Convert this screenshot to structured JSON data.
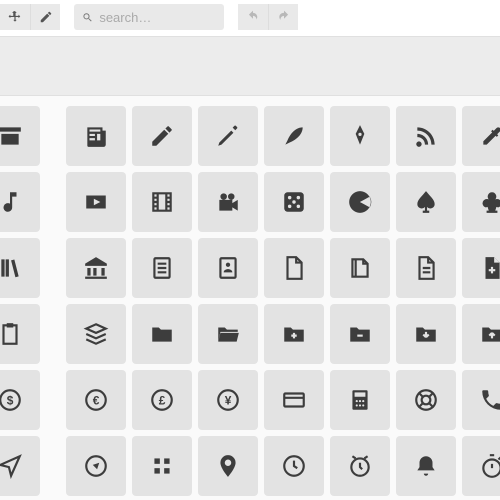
{
  "toolbar": {
    "move_tool": "Move",
    "edit_tool": "Edit",
    "undo": "Undo",
    "redo": "Redo"
  },
  "search": {
    "placeholder": "search…",
    "value": ""
  },
  "icons": [
    [
      "shop-icon",
      "newspaper-icon",
      "pencil-icon",
      "pen-icon",
      "feather-icon",
      "fountain-pen-icon",
      "rss-icon",
      "eyedropper-icon"
    ],
    [
      "music-note-icon",
      "youtube-play-icon",
      "film-icon",
      "video-camera-icon",
      "dice-icon",
      "pacman-icon",
      "spade-icon",
      "club-icon"
    ],
    [
      "books-icon",
      "bank-icon",
      "document-lines-icon",
      "profile-document-icon",
      "file-icon",
      "files-icon",
      "file-text-icon",
      "file-plus-icon"
    ],
    [
      "clipboard-icon",
      "stack-icon",
      "folder-icon",
      "folder-open-icon",
      "folder-plus-icon",
      "folder-minus-icon",
      "folder-download-icon",
      "folder-upload-icon"
    ],
    [
      "dollar-circle-icon",
      "euro-circle-icon",
      "pound-circle-icon",
      "yen-circle-icon",
      "credit-card-icon",
      "calculator-icon",
      "lifebuoy-icon",
      "phone-icon"
    ],
    [
      "location-arrow-icon",
      "compass-icon",
      "grid-small-icon",
      "pin-icon",
      "clock-icon",
      "alarm-icon",
      "bell-icon",
      "stopwatch-icon"
    ]
  ]
}
